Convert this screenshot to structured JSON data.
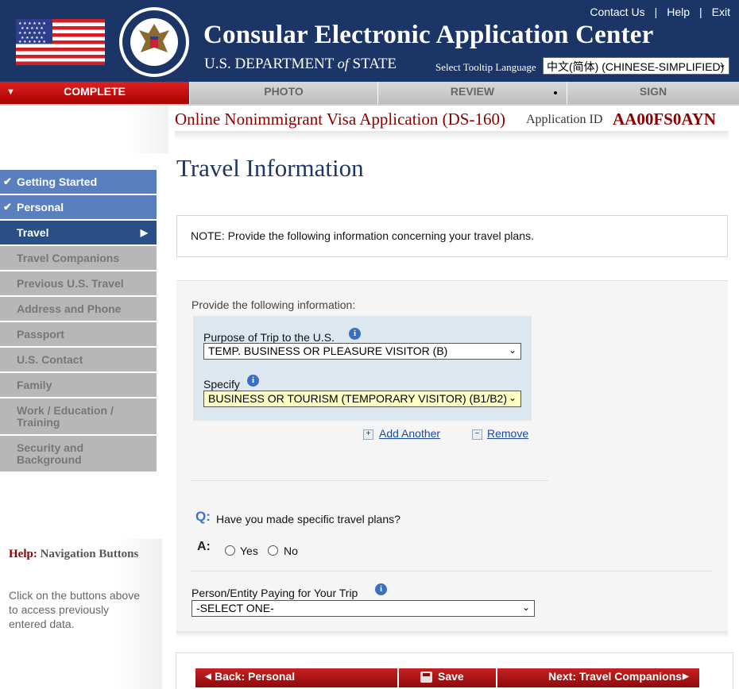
{
  "header": {
    "title": "Consular Electronic Application Center",
    "dept_prefix": "U.S. DEPARTMENT ",
    "dept_of": "of",
    "dept_suffix": " STATE",
    "links": [
      "Contact Us",
      "Help",
      "Exit"
    ],
    "tooltip_language_label": "Select Tooltip Language",
    "tooltip_language_value": "中文(简体)  (CHINESE-SIMPLIFIED)"
  },
  "progress_tabs": [
    "COMPLETE",
    "PHOTO",
    "REVIEW",
    "SIGN"
  ],
  "application": {
    "title": "Online Nonimmigrant Visa Application (DS-160)",
    "id_label": "Application ID",
    "id_value": "AA00FS0AYN"
  },
  "page_title": "Travel Information",
  "sidebar": {
    "items": [
      {
        "label": "Getting Started",
        "state": "done"
      },
      {
        "label": "Personal",
        "state": "done"
      },
      {
        "label": "Travel",
        "state": "current"
      },
      {
        "label": "Travel Companions",
        "state": "todo"
      },
      {
        "label": "Previous U.S. Travel",
        "state": "todo"
      },
      {
        "label": "Address and Phone",
        "state": "todo"
      },
      {
        "label": "Passport",
        "state": "todo"
      },
      {
        "label": "U.S. Contact",
        "state": "todo"
      },
      {
        "label": "Family",
        "state": "todo"
      },
      {
        "label": "Work / Education / Training",
        "state": "todo"
      },
      {
        "label": "Security and Background",
        "state": "todo"
      }
    ]
  },
  "note": "NOTE: Provide the following information concerning your travel plans.",
  "form": {
    "instructions": "Provide the following information:",
    "purpose_label": "Purpose of Trip to the U.S.",
    "purpose_value": "TEMP. BUSINESS OR PLEASURE VISITOR (B)",
    "specify_label": "Specify",
    "specify_value": "BUSINESS OR TOURISM (TEMPORARY VISITOR) (B1/B2)",
    "add_another": "Add Another",
    "remove": "Remove",
    "question_marker": "Q:",
    "question": "Have you made specific travel plans?",
    "answer_marker": "A:",
    "yes": "Yes",
    "no": "No",
    "payer_label": "Person/Entity Paying for Your Trip",
    "payer_value": "-SELECT ONE-"
  },
  "help": {
    "title_prefix": "Help:",
    "title_rest": " Navigation Buttons",
    "body": "Click on the buttons above to access previously entered data."
  },
  "footer": {
    "back": "Back: Personal",
    "save": "Save",
    "next": "Next: Travel Companions"
  },
  "colors": {
    "header_bg": "#1a3566",
    "active_red": "#c52020",
    "nav_done": "#5a7fbf",
    "nav_current": "#2a4e86",
    "nav_todo": "#b7b7b7",
    "title_dark_red": "#8b0000"
  }
}
